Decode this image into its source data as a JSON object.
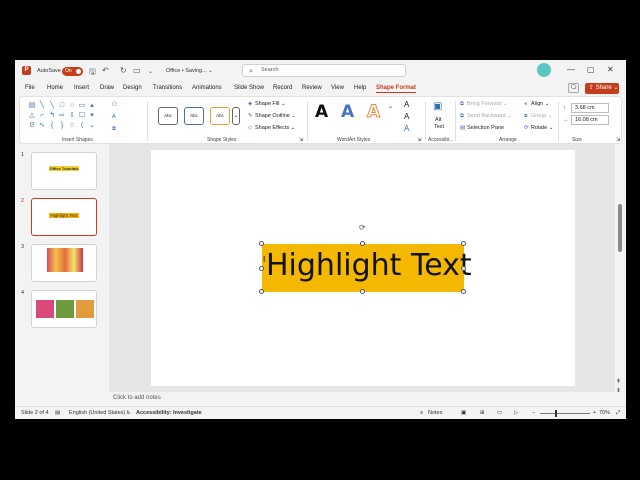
{
  "title_bar": {
    "autosave_label": "AutoSave",
    "autosave_state": "On",
    "doc_name": "Office  •  Saving...  ⌄",
    "search_placeholder": "Search"
  },
  "menu": {
    "tabs": [
      "File",
      "Home",
      "Insert",
      "Draw",
      "Design",
      "Transitions",
      "Animations",
      "Slide Show",
      "Record",
      "Review",
      "View",
      "Help",
      "Shape Format"
    ],
    "active_tab": "Shape Format",
    "share_label": "Share"
  },
  "ribbon": {
    "insert_shapes_label": "Insert Shapes",
    "shape_styles_label": "Shape Styles",
    "style_box_label": "Abc",
    "shape_fill": "Shape Fill",
    "shape_outline": "Shape Outline",
    "shape_effects": "Shape Effects",
    "wordart_label": "WordArt Styles",
    "wordart_letter": "A",
    "alt_text_1": "Alt",
    "alt_text_2": "Text",
    "accessibility_label": "Accessibi...",
    "bring_forward": "Bring Forward",
    "send_backward": "Send Backward",
    "selection_pane": "Selection Pane",
    "align": "Align",
    "group": "Group",
    "rotate": "Rotate",
    "arrange_label": "Arrange",
    "height_value": "3.68 cm",
    "width_value": "16.08 cm",
    "size_label": "Size"
  },
  "thumbnails": {
    "numbers": [
      "1",
      "2",
      "3",
      "4"
    ],
    "slide1_title": "Office Tutorials",
    "slide2_title": "Highlight Text"
  },
  "slide": {
    "textbox_text": "Highlight Text",
    "highlight_color": "#f5b800"
  },
  "notes_placeholder": "Click to add notes",
  "status": {
    "slide_info": "Slide 2 of 4",
    "language": "English (United States)",
    "accessibility": "Accessibility: Investigate",
    "notes": "Notes",
    "zoom": "70%"
  },
  "colors": {
    "accent": "#c43e1c",
    "ribbon_bg": "#ffffff",
    "app_bg": "#f3f3f3"
  }
}
